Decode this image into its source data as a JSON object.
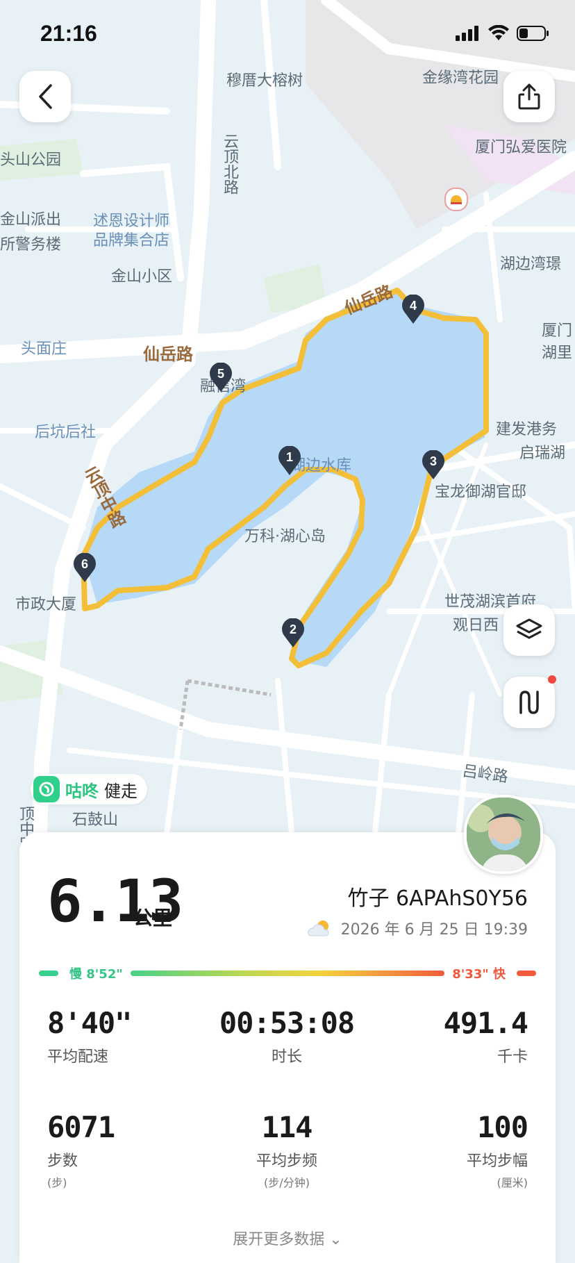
{
  "status_bar": {
    "time": "21:16"
  },
  "map": {
    "labels": {
      "l1": "穆厝大榕树",
      "l2": "金缘湾花园",
      "l3": "厦门弘爱医院",
      "l4": "头山公园",
      "l5": "云顶北路",
      "l6": "金山派出",
      "l7": "所警务楼",
      "l8": "述恩设计师",
      "l9": "品牌集合店",
      "l10": "金山小区",
      "l11": "湖边湾璟",
      "l12": "厦门",
      "l13": "湖里",
      "l14": "头面庄",
      "l15": "仙岳路",
      "l16": "仙岳路",
      "l17": "融信湾",
      "l18": "后坑后社",
      "l19": "建发港务",
      "l20": "启瑞湖",
      "l21": "湖边水库",
      "l22": "云顶中路",
      "l23": "宝龙御湖官邸",
      "l24": "万科·湖心岛",
      "l25": "市政大厦",
      "l26": "世茂湖滨首府",
      "l27": "观日西",
      "l28": "吕岭路",
      "l29": "石鼓山",
      "l30": "顶中路"
    },
    "pins": [
      "1",
      "2",
      "3",
      "4",
      "5",
      "6"
    ]
  },
  "brand": {
    "name": "咕咚",
    "mode": "健走"
  },
  "summary": {
    "distance": "6.13",
    "distance_unit": "公里",
    "username": "竹子 6APAhS0Y56",
    "datetime": "2026 年 6 月 25 日 19:39",
    "weather_icon": "partly-cloudy-icon"
  },
  "pace_bar": {
    "slow_label": "慢 8'52\"",
    "fast_label": "8'33\" 快"
  },
  "stats": {
    "avg_pace": {
      "value": "8'40\"",
      "label": "平均配速"
    },
    "duration": {
      "value": "00:53:08",
      "label": "时长"
    },
    "calories": {
      "value": "491.4",
      "label": "千卡"
    },
    "steps": {
      "value": "6071",
      "label": "步数",
      "unit": "(步)"
    },
    "cadence": {
      "value": "114",
      "label": "平均步频",
      "unit": "(步/分钟)"
    },
    "stride": {
      "value": "100",
      "label": "平均步幅",
      "unit": "(厘米)"
    }
  },
  "more_label": "展开更多数据 ⌄"
}
